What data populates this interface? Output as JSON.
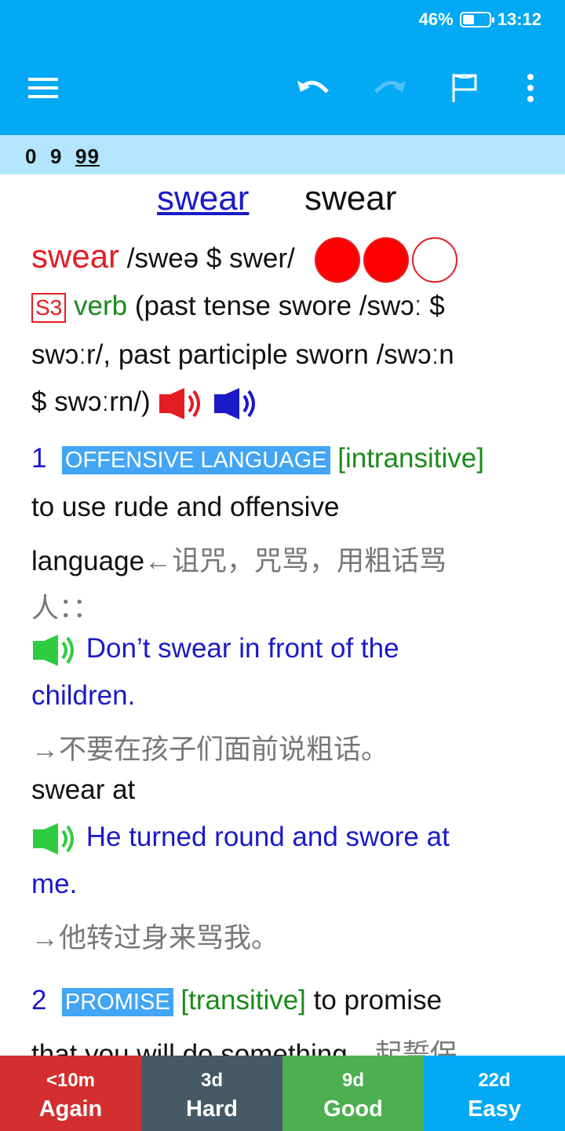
{
  "status": {
    "battery": "46%",
    "time": "13:12"
  },
  "toolbar": {
    "menu_icon": "hamburger-icon",
    "undo_icon": "undo-icon",
    "redo_icon": "redo-icon",
    "flag_icon": "flag-icon",
    "more_icon": "more-vert-icon"
  },
  "counter": {
    "new": "0",
    "learn": "9",
    "review": "99"
  },
  "headword": {
    "link": "swear",
    "plain": "swear"
  },
  "entry": {
    "word": "swear",
    "pron": "/sweə $ swer/",
    "frequency": {
      "level": 2,
      "max": 3
    },
    "badge": "S3",
    "pos": "verb",
    "forms_1": "(past tense swore /swɔː $",
    "forms_2": "swɔːr/, past participle sworn /swɔːn",
    "forms_3": "$ swɔːrn/)"
  },
  "sense1": {
    "num": "1",
    "label": "OFFENSIVE LANGUAGE",
    "gram": "[intransitive]",
    "def_1": "to use rude and offensive",
    "def_2": "language",
    "def_cn_1": "←诅咒，咒骂，用粗话骂",
    "def_cn_2": "人：：",
    "ex1_1": "Don’t swear in front of the",
    "ex1_2": "children.",
    "ex1_cn": "→不要在孩子们面前说粗话。",
    "phrase": "swear at",
    "ex2_1": "He turned round and swore at",
    "ex2_2": "me.",
    "ex2_cn": "→他转过身来骂我。"
  },
  "sense2": {
    "num": "2",
    "label": "PROMISE",
    "gram": "[transitive]",
    "def_1": "to promise",
    "def_2": "that you will do something",
    "def_cn": "←起誓保"
  },
  "buttons": [
    {
      "time": "<10m",
      "label": "Again"
    },
    {
      "time": "3d",
      "label": "Hard"
    },
    {
      "time": "9d",
      "label": "Good"
    },
    {
      "time": "22d",
      "label": "Easy"
    }
  ]
}
